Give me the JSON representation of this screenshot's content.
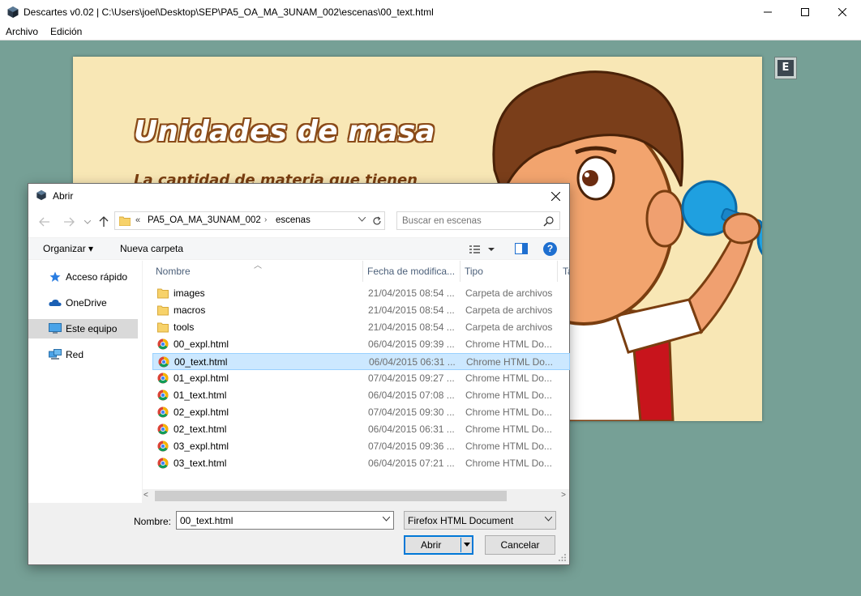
{
  "window": {
    "title": "Descartes v0.02 | C:\\Users\\joel\\Desktop\\SEP\\PA5_OA_MA_3UNAM_002\\escenas\\00_text.html",
    "minimize_icon": "minimize-icon",
    "maximize_icon": "maximize-icon",
    "close_icon": "close-icon"
  },
  "menu": {
    "items": [
      "Archivo",
      "Edición"
    ]
  },
  "scene": {
    "title": "Unidades de masa",
    "subtitle_partial": "La cantidad de materia que tienen",
    "e_button": "E",
    "colors": {
      "background": "#f8e7b5",
      "title_outline": "#8a4a18"
    }
  },
  "dialog": {
    "title": "Abrir",
    "nav": {
      "back_icon": "arrow-left-icon",
      "forward_icon": "arrow-right-icon",
      "up_icon": "arrow-up-icon",
      "path_prefix": "«",
      "crumbs": [
        "PA5_OA_MA_3UNAM_002",
        "escenas"
      ],
      "search_placeholder": "Buscar en escenas"
    },
    "toolbar": {
      "organize": "Organizar ▾",
      "new_folder": "Nueva carpeta",
      "help": "?"
    },
    "sidebar": [
      {
        "label": "Acceso rápido",
        "icon": "star-icon",
        "selected": false
      },
      {
        "label": "OneDrive",
        "icon": "cloud-icon",
        "selected": false
      },
      {
        "label": "Este equipo",
        "icon": "computer-icon",
        "selected": true
      },
      {
        "label": "Red",
        "icon": "network-icon",
        "selected": false
      }
    ],
    "columns": [
      "Nombre",
      "Fecha de modifica...",
      "Tipo",
      "Ta"
    ],
    "files": [
      {
        "name": "images",
        "date": "21/04/2015 08:54 ...",
        "type": "Carpeta de archivos",
        "icon": "folder-icon",
        "selected": false
      },
      {
        "name": "macros",
        "date": "21/04/2015 08:54 ...",
        "type": "Carpeta de archivos",
        "icon": "folder-icon",
        "selected": false
      },
      {
        "name": "tools",
        "date": "21/04/2015 08:54 ...",
        "type": "Carpeta de archivos",
        "icon": "folder-icon",
        "selected": false
      },
      {
        "name": "00_expl.html",
        "date": "06/04/2015 09:39 ...",
        "type": "Chrome HTML Do...",
        "icon": "chrome-icon",
        "selected": false
      },
      {
        "name": "00_text.html",
        "date": "06/04/2015 06:31 ...",
        "type": "Chrome HTML Do...",
        "icon": "chrome-icon",
        "selected": true
      },
      {
        "name": "01_expl.html",
        "date": "07/04/2015 09:27 ...",
        "type": "Chrome HTML Do...",
        "icon": "chrome-icon",
        "selected": false
      },
      {
        "name": "01_text.html",
        "date": "06/04/2015 07:08 ...",
        "type": "Chrome HTML Do...",
        "icon": "chrome-icon",
        "selected": false
      },
      {
        "name": "02_expl.html",
        "date": "07/04/2015 09:30 ...",
        "type": "Chrome HTML Do...",
        "icon": "chrome-icon",
        "selected": false
      },
      {
        "name": "02_text.html",
        "date": "06/04/2015 06:31 ...",
        "type": "Chrome HTML Do...",
        "icon": "chrome-icon",
        "selected": false
      },
      {
        "name": "03_expl.html",
        "date": "07/04/2015 09:36 ...",
        "type": "Chrome HTML Do...",
        "icon": "chrome-icon",
        "selected": false
      },
      {
        "name": "03_text.html",
        "date": "06/04/2015 07:21 ...",
        "type": "Chrome HTML Do...",
        "icon": "chrome-icon",
        "selected": false
      }
    ],
    "filename_label": "Nombre:",
    "filename_value": "00_text.html",
    "filetype": "Firefox HTML Document",
    "open_label": "Abrir",
    "cancel_label": "Cancelar"
  }
}
